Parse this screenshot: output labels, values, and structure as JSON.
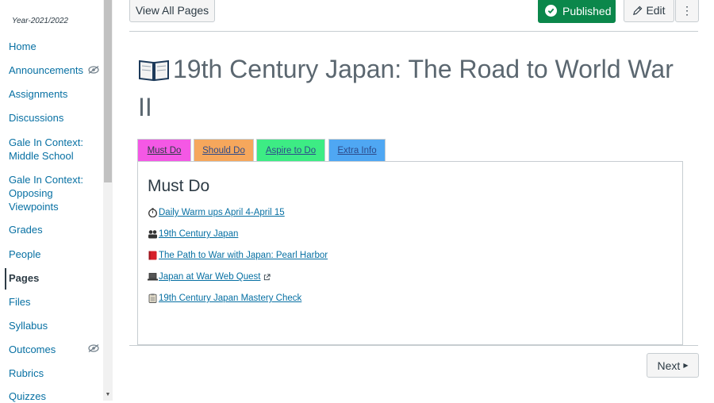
{
  "sidebar": {
    "year": "Year-2021/2022",
    "items": [
      {
        "label": "Home"
      },
      {
        "label": "Announcements"
      },
      {
        "label": "Assignments"
      },
      {
        "label": "Discussions"
      },
      {
        "label": "Gale In Context: Middle School"
      },
      {
        "label": "Gale In Context: Opposing Viewpoints"
      },
      {
        "label": "Grades"
      },
      {
        "label": "People"
      },
      {
        "label": "Pages"
      },
      {
        "label": "Files"
      },
      {
        "label": "Syllabus"
      },
      {
        "label": "Outcomes"
      },
      {
        "label": "Rubrics"
      },
      {
        "label": "Quizzes"
      }
    ]
  },
  "header": {
    "view_all": "View All Pages",
    "published": "Published",
    "edit": "Edit",
    "more": "⋮"
  },
  "page": {
    "title": "19th Century Japan: The Road to World War II"
  },
  "tabs": [
    "Must Do",
    "Should Do",
    "Aspire to Do",
    "Extra Info"
  ],
  "panel": {
    "heading": "Must Do",
    "links": [
      {
        "text": "Daily Warm ups April 4-April 15",
        "icon": "stopwatch-icon"
      },
      {
        "text": "19th Century Japan",
        "icon": "group-icon"
      },
      {
        "text": "The Path to War with Japan: Pearl Harbor",
        "icon": "red-book-icon"
      },
      {
        "text": "Japan at War Web Quest",
        "icon": "laptop-icon"
      },
      {
        "text": "19th Century Japan Mastery Check",
        "icon": "clipboard-icon"
      }
    ]
  },
  "footer": {
    "next": "Next"
  },
  "colors": {
    "link": "#0770a3",
    "published": "#0b874b",
    "must_do": "#f458e5",
    "should_do": "#f6a75c",
    "aspire": "#3dec84",
    "extra": "#4fa7f3"
  }
}
